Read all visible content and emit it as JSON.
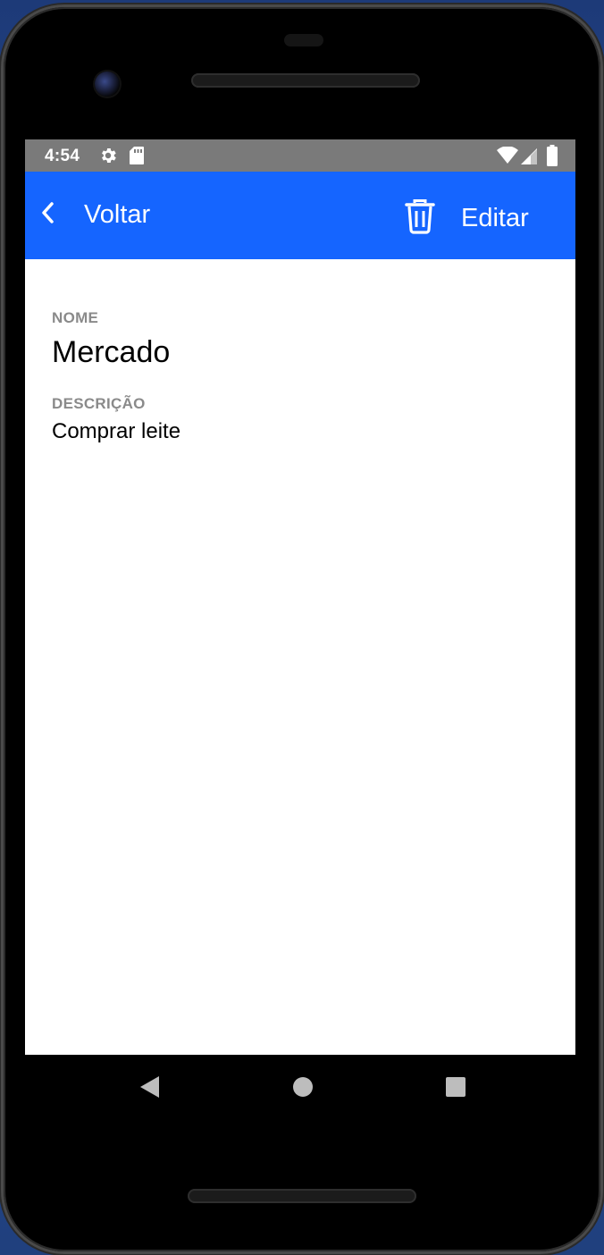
{
  "status_bar": {
    "time": "4:54",
    "icons": [
      "gear-icon",
      "sd-card-icon",
      "wifi-icon",
      "signal-icon",
      "battery-icon"
    ]
  },
  "app_bar": {
    "back_label": "Voltar",
    "edit_label": "Editar",
    "icons": [
      "chevron-left-icon",
      "trash-icon"
    ],
    "background_color": "#1565ff"
  },
  "detail": {
    "name_label": "NOME",
    "name_value": "Mercado",
    "description_label": "DESCRIÇÃO",
    "description_value": "Comprar leite"
  },
  "nav_bar": {
    "icons": [
      "back-triangle-icon",
      "home-circle-icon",
      "recents-square-icon"
    ]
  }
}
